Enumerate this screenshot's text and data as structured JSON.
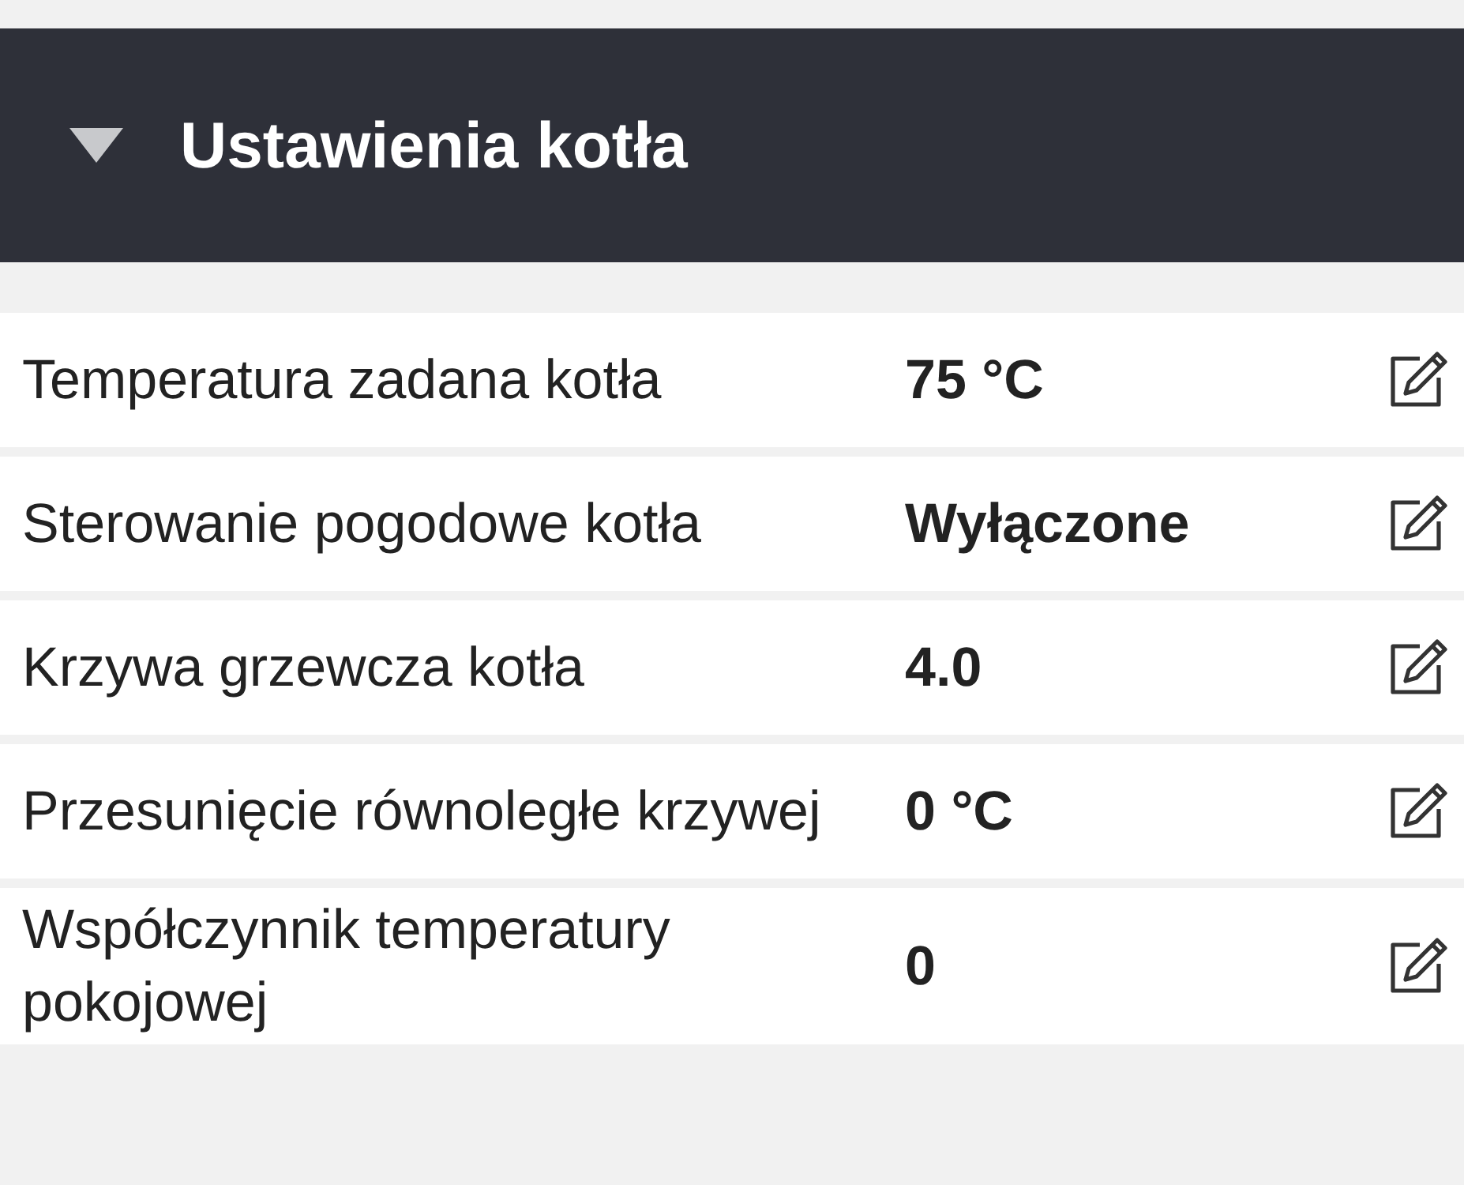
{
  "section": {
    "title": "Ustawienia kotła",
    "expanded": true
  },
  "rows": [
    {
      "label": "Temperatura zadana kotła",
      "value": "75 °C"
    },
    {
      "label": "Sterowanie pogodowe kotła",
      "value": "Wyłączone"
    },
    {
      "label": "Krzywa grzewcza kotła",
      "value": "4.0"
    },
    {
      "label": "Przesunięcie równoległe krzywej",
      "value": "0 °C"
    },
    {
      "label": "Współczynnik temperatury pokojowej",
      "value": "0"
    }
  ]
}
